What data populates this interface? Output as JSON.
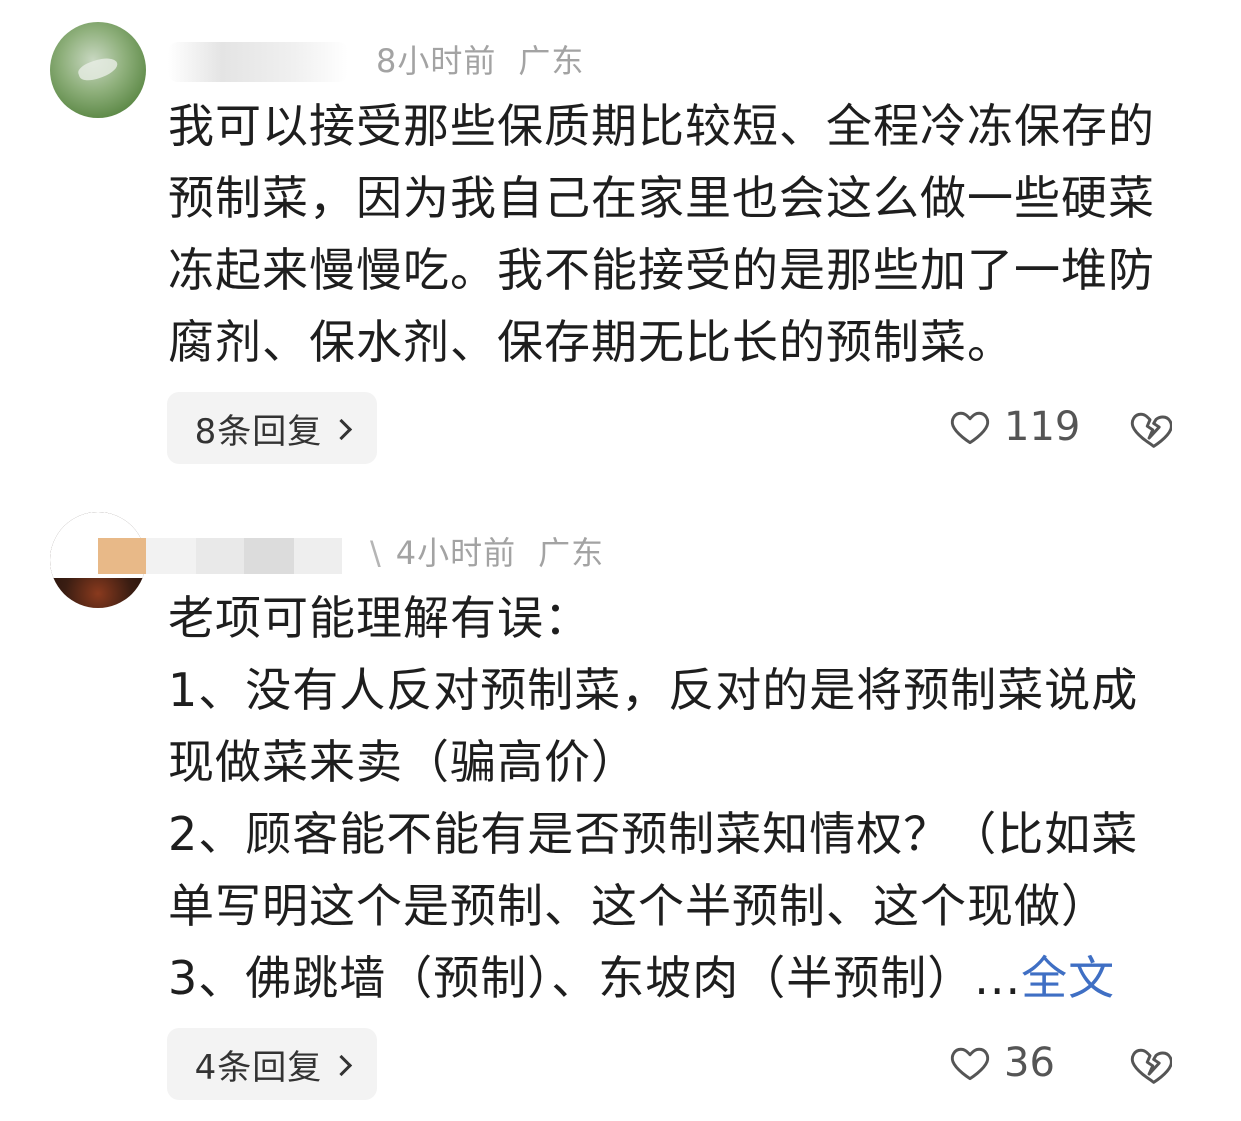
{
  "comments": [
    {
      "time": "8小时前",
      "location": "广东",
      "lines": [
        "我可以接受那些保质期比较短、全程冷冻保存的",
        "预制菜，因为我自己在家里也会这么做一些硬菜",
        "冻起来慢慢吃。我不能接受的是那些加了一堆防",
        "腐剂、保水剂、保存期无比长的预制菜。"
      ],
      "replies_label": "8条回复",
      "likes": "119"
    },
    {
      "time": "4小时前",
      "location": "广东",
      "lines": [
        "老项可能理解有误：",
        "1、没有人反对预制菜，反对的是将预制菜说成",
        "现做菜来卖（骗高价）",
        "2、顾客能不能有是否预制菜知情权？（比如菜",
        "单写明这个是预制、这个半预制、这个现做）",
        "3、佛跳墙（预制）、东坡肉（半预制）..."
      ],
      "more_label": "全文",
      "replies_label": "4条回复",
      "likes": "36"
    }
  ],
  "icons": {
    "like": "heart-outline-icon",
    "dislike": "broken-heart-icon",
    "avatar": "user-avatar"
  },
  "colors": {
    "meta_text": "#a3a3a3",
    "link": "#3f6fc4",
    "pill_bg": "#f3f3f3"
  }
}
